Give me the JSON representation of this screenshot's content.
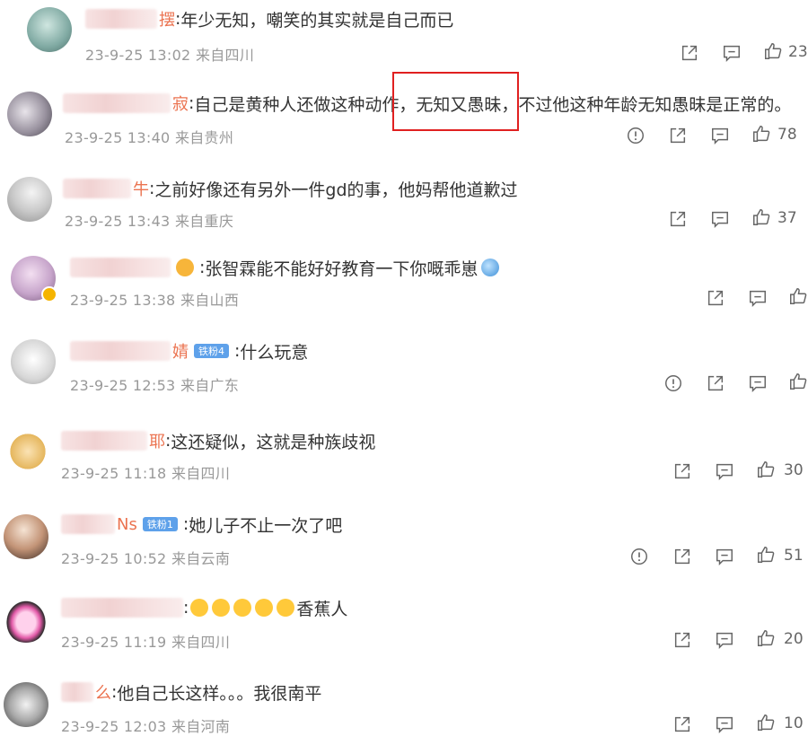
{
  "comments": [
    {
      "tail": "摆",
      "text": "年少无知，嘲笑的其实就是自己而已",
      "time": "23-9-25 13:02",
      "loc": "来自四川",
      "likes": "23"
    },
    {
      "tail": "寂",
      "text": "自己是黄种人还做这种动作，无知又愚昧，不过他这种年龄无知愚昧是正常的。",
      "time": "23-9-25 13:40",
      "loc": "来自贵州",
      "likes": "78"
    },
    {
      "tail": "牛",
      "text": "之前好像还有另外一件gd的事，他妈帮他道歉过",
      "time": "23-9-25 13:43",
      "loc": "来自重庆",
      "likes": "37"
    },
    {
      "tail": "",
      "text": "张智霖能不能好好教育一下你嘅乖崽",
      "time": "23-9-25 13:38",
      "loc": "来自山西",
      "likes": ""
    },
    {
      "tail": "",
      "badge": "铁粉4",
      "text": "什么玩意",
      "time": "23-9-25 12:53",
      "loc": "来自广东",
      "likes": ""
    },
    {
      "tail": "耶",
      "text": "这还疑似，这就是种族歧视",
      "time": "23-9-25 11:18",
      "loc": "来自四川",
      "likes": "30"
    },
    {
      "tail": "Ns",
      "badge": "铁粉1",
      "text": "她儿子不止一次了吧",
      "time": "23-9-25 10:52",
      "loc": "来自云南",
      "likes": "51"
    },
    {
      "tail": "",
      "text": "香蕉人",
      "time": "23-9-25 11:19",
      "loc": "来自四川",
      "likes": "20"
    },
    {
      "tail": "么",
      "text": "他自己长这样。。。我很南平",
      "time": "23-9-25 12:03",
      "loc": "来自河南",
      "likes": "10"
    }
  ],
  "icons": {
    "share": "share-icon",
    "comment": "comment-icon",
    "like": "thumbs-up-icon",
    "report": "report-icon"
  },
  "colors": {
    "name": "#eb7350",
    "highlight": "#e02020",
    "badge": "#5ea1ea"
  }
}
